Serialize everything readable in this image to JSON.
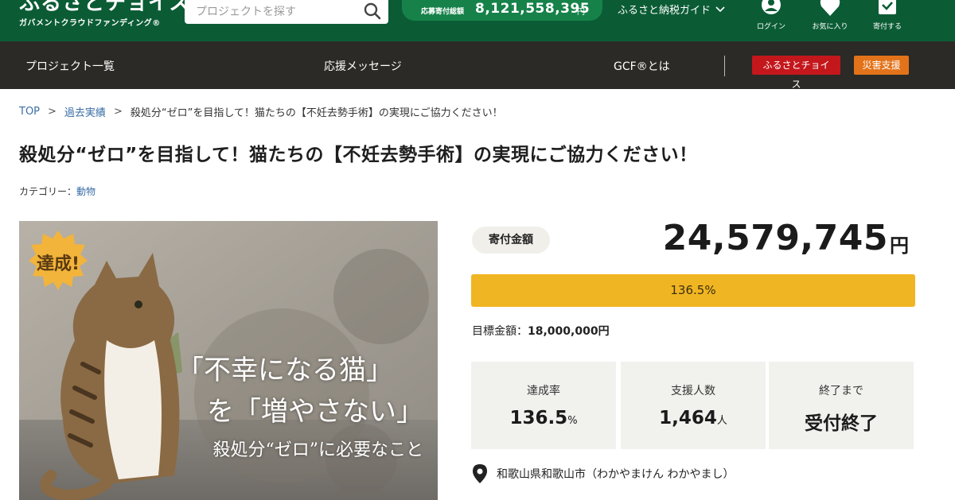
{
  "header": {
    "logo_main": "ふるさとチョイス",
    "logo_sub": "ガバメントクラウドファンディング®",
    "search_placeholder": "プロジェクトを探す",
    "donation_label": "応募寄付総額",
    "donation_total": "8,121,558,395",
    "donation_unit": "円",
    "guide_label": "ふるさと納税ガイド",
    "icons": [
      {
        "label": "ログイン",
        "icon": "user-icon"
      },
      {
        "label": "お気に入り",
        "icon": "heart-icon"
      },
      {
        "label": "寄付する",
        "icon": "donate-box-icon"
      }
    ]
  },
  "nav": {
    "items": [
      "プロジェクト一覧",
      "応援メッセージ",
      "GCF®とは"
    ],
    "buttons": [
      "ふるさとチョイス",
      "災害支援"
    ]
  },
  "breadcrumb": {
    "top": "TOP",
    "past": "過去実績",
    "sep": ">",
    "current": "殺処分“ゼロ”を目指して！猫たちの【不妊去勢手術】の実現にご協力ください！"
  },
  "title": "殺処分“ゼロ”を目指して！猫たちの【不妊去勢手術】の実現にご協力ください！",
  "category": {
    "label": "カテゴリー：",
    "value": "動物"
  },
  "hero": {
    "badge": "達成!",
    "line1": "「不幸になる猫」",
    "line2": "を「増やさない」",
    "line3": "殺処分“ゼロ”に必要なこと"
  },
  "donation": {
    "label": "寄付金額",
    "amount": "24,579,745",
    "unit": "円",
    "progress_text": "136.5%",
    "progress_fraction": 1.0,
    "target_label": "目標金額：",
    "target_value": "18,000,000円"
  },
  "stats": [
    {
      "label": "達成率",
      "value": "136.5",
      "unit": "%"
    },
    {
      "label": "支援人数",
      "value": "1,464",
      "unit": "人"
    },
    {
      "label": "終了まで",
      "value": "受付終了",
      "unit": ""
    }
  ],
  "location": "和歌山県和歌山市（わかやまけん わかやまし）",
  "colors": {
    "header_green": "#0b5c35",
    "nav_dark": "#2b2a26",
    "progress_yellow": "#f0b522",
    "link_blue": "#3a6ea5",
    "choice_red": "#c4171c",
    "disaster_orange": "#e3731a"
  }
}
